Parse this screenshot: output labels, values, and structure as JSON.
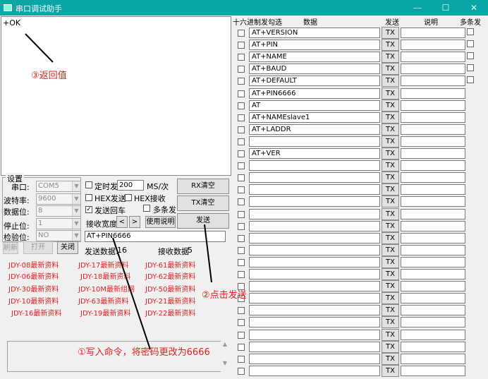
{
  "window": {
    "title": "串口调试助手",
    "minimize": "—",
    "maximize": "☐",
    "close": "✕"
  },
  "receive": {
    "text": "+OK"
  },
  "settings": {
    "legend": "设置",
    "port_label": "串口:",
    "port_value": "COM5",
    "baud_label": "波特率:",
    "baud_value": "9600",
    "databits_label": "数据位:",
    "databits_value": "8",
    "stopbits_label": "停止位:",
    "stopbits_value": "1",
    "parity_label": "检验位:",
    "parity_value": "NO"
  },
  "buttons": {
    "refresh": "刷新",
    "open": "打开",
    "close": "关闭",
    "rx_clear": "RX清空",
    "tx_clear": "TX清空",
    "send": "发送",
    "usage": "使用说明",
    "prev": "<",
    "next": ">"
  },
  "options": {
    "timer_label": "定时发",
    "timer_value": "200",
    "timer_unit": "MS/次",
    "hex_send": "HEX发送",
    "hex_recv": "HEX接收",
    "send_newline": "发送回车",
    "newline_checked": "✓",
    "multi_send": "多条发",
    "recv_width": "接收宽度"
  },
  "send_input": {
    "value": "AT+PIN6666"
  },
  "status": {
    "sent_label": "发送数据:",
    "sent_value": "16",
    "recv_label": "接收数据",
    "recv_value": "5"
  },
  "links": [
    "JDY-08最新资料",
    "JDY-17最新资料",
    "JDY-61最新资料",
    "JDY-06最新资料",
    "JDY-18最新资料",
    "JDY-62最新资料",
    "JDY-30最新资料",
    "JDY-10M最新组网",
    "JDY-50最新资料",
    "JDY-10最新资料",
    "JDY-63最新资料",
    "JDY-21最新资料",
    "JDY-16最新资料",
    "JDY-19最新资料",
    "JDY-22最新资料"
  ],
  "right_panel": {
    "hex_header": "十六进制发勾选",
    "data_header": "数据",
    "send_header": "发送",
    "desc_header": "说明",
    "multi_header": "多条发",
    "tx_label": "TX",
    "commands": [
      "AT+VERSION",
      "AT+PIN",
      "AT+NAME",
      "AT+BAUD",
      "AT+DEFAULT",
      "AT+PIN6666",
      "AT",
      "AT+NAMEslave1",
      "AT+LADDR",
      "",
      "AT+VER",
      "",
      "",
      "",
      "",
      "",
      "",
      "",
      "",
      "",
      "",
      "",
      "",
      "",
      "",
      "",
      "",
      "",
      ""
    ]
  },
  "annotations": {
    "return_value": "③返回值",
    "click_send": "②点击发送",
    "write_command": "①写入命令，将密码更改为6666"
  },
  "colors": {
    "titlebar": "#0aa6a6",
    "annotation": "#e02020"
  }
}
